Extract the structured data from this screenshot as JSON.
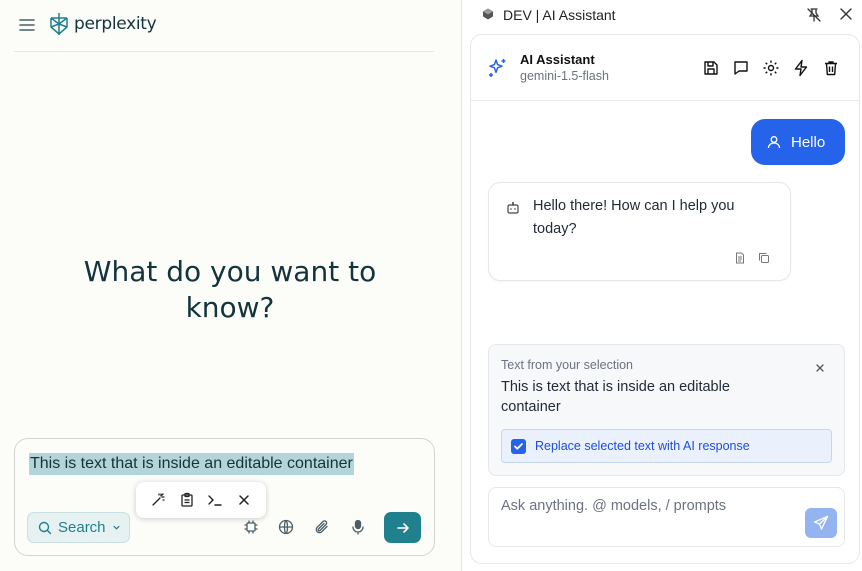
{
  "left": {
    "logo_text": "perplexity",
    "headline": "What do you want to know?",
    "input": {
      "selected_text": "This is text that is inside an editable container"
    },
    "search_mode_label": "Search",
    "icons": [
      "menu-icon",
      "perplexity-logo-icon",
      "magic-wand-icon",
      "clipboard-icon",
      "terminal-icon",
      "close-icon",
      "search-icon",
      "chip-icon",
      "globe-icon",
      "paperclip-icon",
      "mic-icon",
      "arrow-right-icon"
    ]
  },
  "right": {
    "window_title": "DEV | AI Assistant",
    "assistant_name": "AI Assistant",
    "model_name": "gemini-1.5-flash",
    "messages": [
      {
        "role": "user",
        "text": "Hello"
      },
      {
        "role": "assistant",
        "text": "Hello there! How can I help you today?"
      }
    ],
    "selection": {
      "label": "Text from your selection",
      "text": "This is text that is inside an editable container",
      "replace_label": "Replace selected text with AI response",
      "replace_checked": true
    },
    "ask_placeholder": "Ask anything. @ models, / prompts",
    "colors": {
      "accent_blue": "#2563eb",
      "send_disabled": "#93b4f1",
      "perplexity_teal": "#20808d"
    }
  }
}
